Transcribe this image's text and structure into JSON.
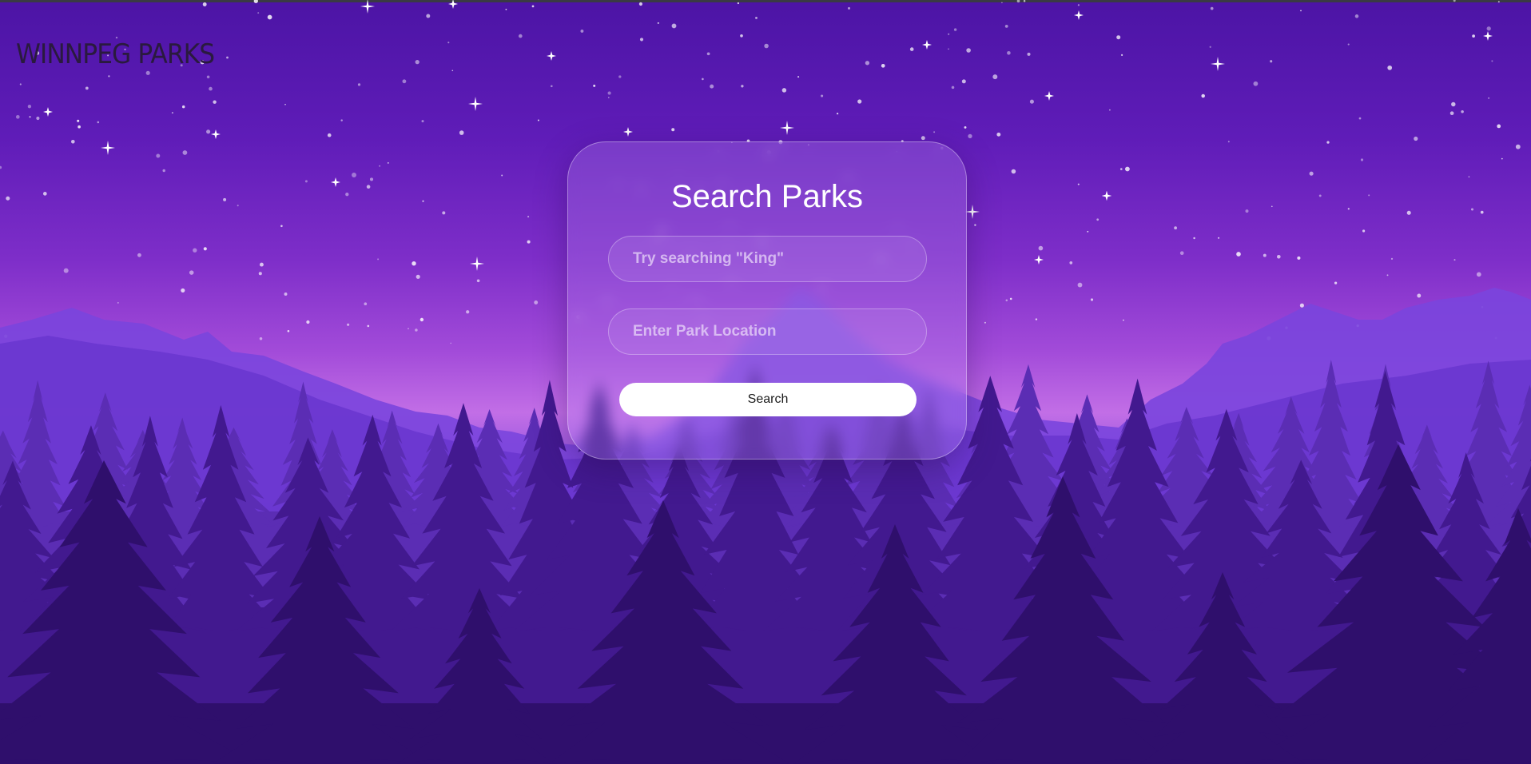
{
  "header": {
    "brand": "WINNPEG PARKS"
  },
  "search_card": {
    "title": "Search Parks",
    "query_placeholder": "Try searching \"King\"",
    "location_placeholder": "Enter Park Location",
    "search_label": "Search"
  },
  "colors": {
    "sky_top": "#4c14a5",
    "horizon_glow": "#c26ee6",
    "far_mountains": "#7a45dd",
    "mid_forest": "#5b2db4",
    "near_forest": "#3a1680",
    "front_forest": "#2c0f66",
    "button_bg": "#ffffff"
  },
  "icons": [
    "sparkle-star-icon"
  ]
}
